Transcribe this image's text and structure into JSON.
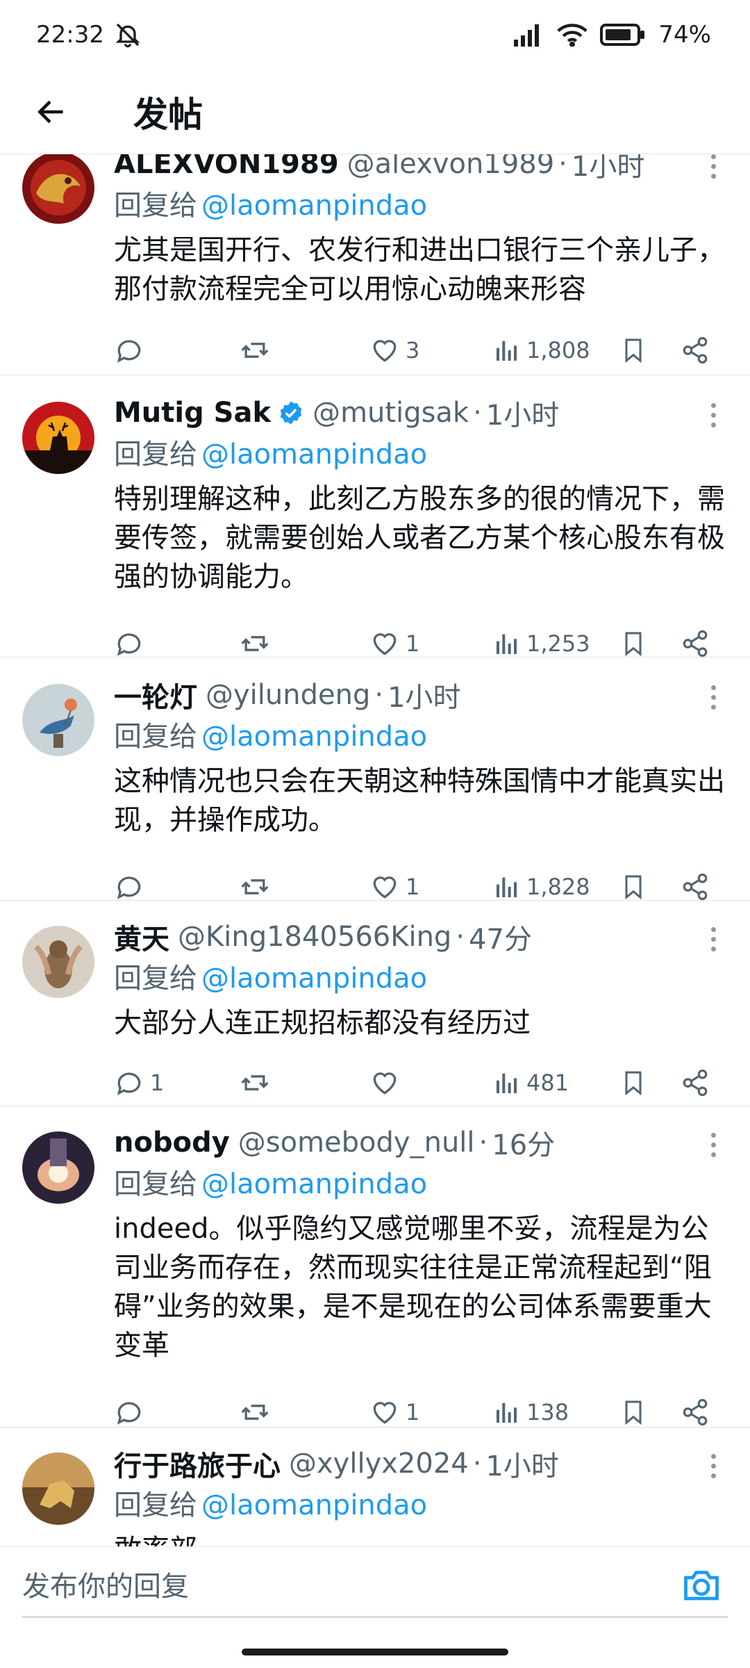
{
  "status_bar": {
    "time": "22:32",
    "battery": "74%"
  },
  "header": {
    "title": "发帖"
  },
  "reply_prefix": "回复给",
  "tweets": [
    {
      "name": "ALEXVON1989",
      "handle": "@alexvon1989",
      "time": "1小时",
      "verified": false,
      "reply_to": "@laomanpindao",
      "text": "尤其是国开行、农发行和进出口银行三个亲儿子，那付款流程完全可以用惊心动魄来形容",
      "replies": "",
      "retweets": "",
      "likes": "3",
      "views": "1,808"
    },
    {
      "name": "Mutig Sak",
      "handle": "@mutigsak",
      "time": "1小时",
      "verified": true,
      "reply_to": "@laomanpindao",
      "text": "特别理解这种，此刻乙方股东多的很的情况下，需要传签，就需要创始人或者乙方某个核心股东有极强的协调能力。",
      "replies": "",
      "retweets": "",
      "likes": "1",
      "views": "1,253"
    },
    {
      "name": "一轮灯",
      "handle": "@yilundeng",
      "time": "1小时",
      "verified": false,
      "reply_to": "@laomanpindao",
      "text": "这种情况也只会在天朝这种特殊国情中才能真实出现，并操作成功。",
      "replies": "",
      "retweets": "",
      "likes": "1",
      "views": "1,828"
    },
    {
      "name": "黄天",
      "handle": "@King1840566King",
      "time": "47分",
      "verified": false,
      "reply_to": "@laomanpindao",
      "text": "大部分人连正规招标都没有经历过",
      "replies": "1",
      "retweets": "",
      "likes": "",
      "views": "481"
    },
    {
      "name": "nobody",
      "handle": "@somebody_null",
      "time": "16分",
      "verified": false,
      "reply_to": "@laomanpindao",
      "text": "indeed。似乎隐约又感觉哪里不妥，流程是为公司业务而存在，然而现实往往是正常流程起到“阻碍”业务的效果，是不是现在的公司体系需要重大变革",
      "replies": "",
      "retweets": "",
      "likes": "1",
      "views": "138"
    },
    {
      "name": "行于路旅于心",
      "handle": "@xyllyx2024",
      "time": "1小时",
      "verified": false,
      "reply_to": "@laomanpindao",
      "text": "敢率部",
      "replies": "",
      "retweets": "",
      "likes": "",
      "views": ""
    }
  ],
  "composer": {
    "placeholder": "发布你的回复"
  },
  "colors": {
    "accent": "#1d9bf0",
    "secondary_text": "#536471",
    "verified": "#1d9bf0"
  }
}
